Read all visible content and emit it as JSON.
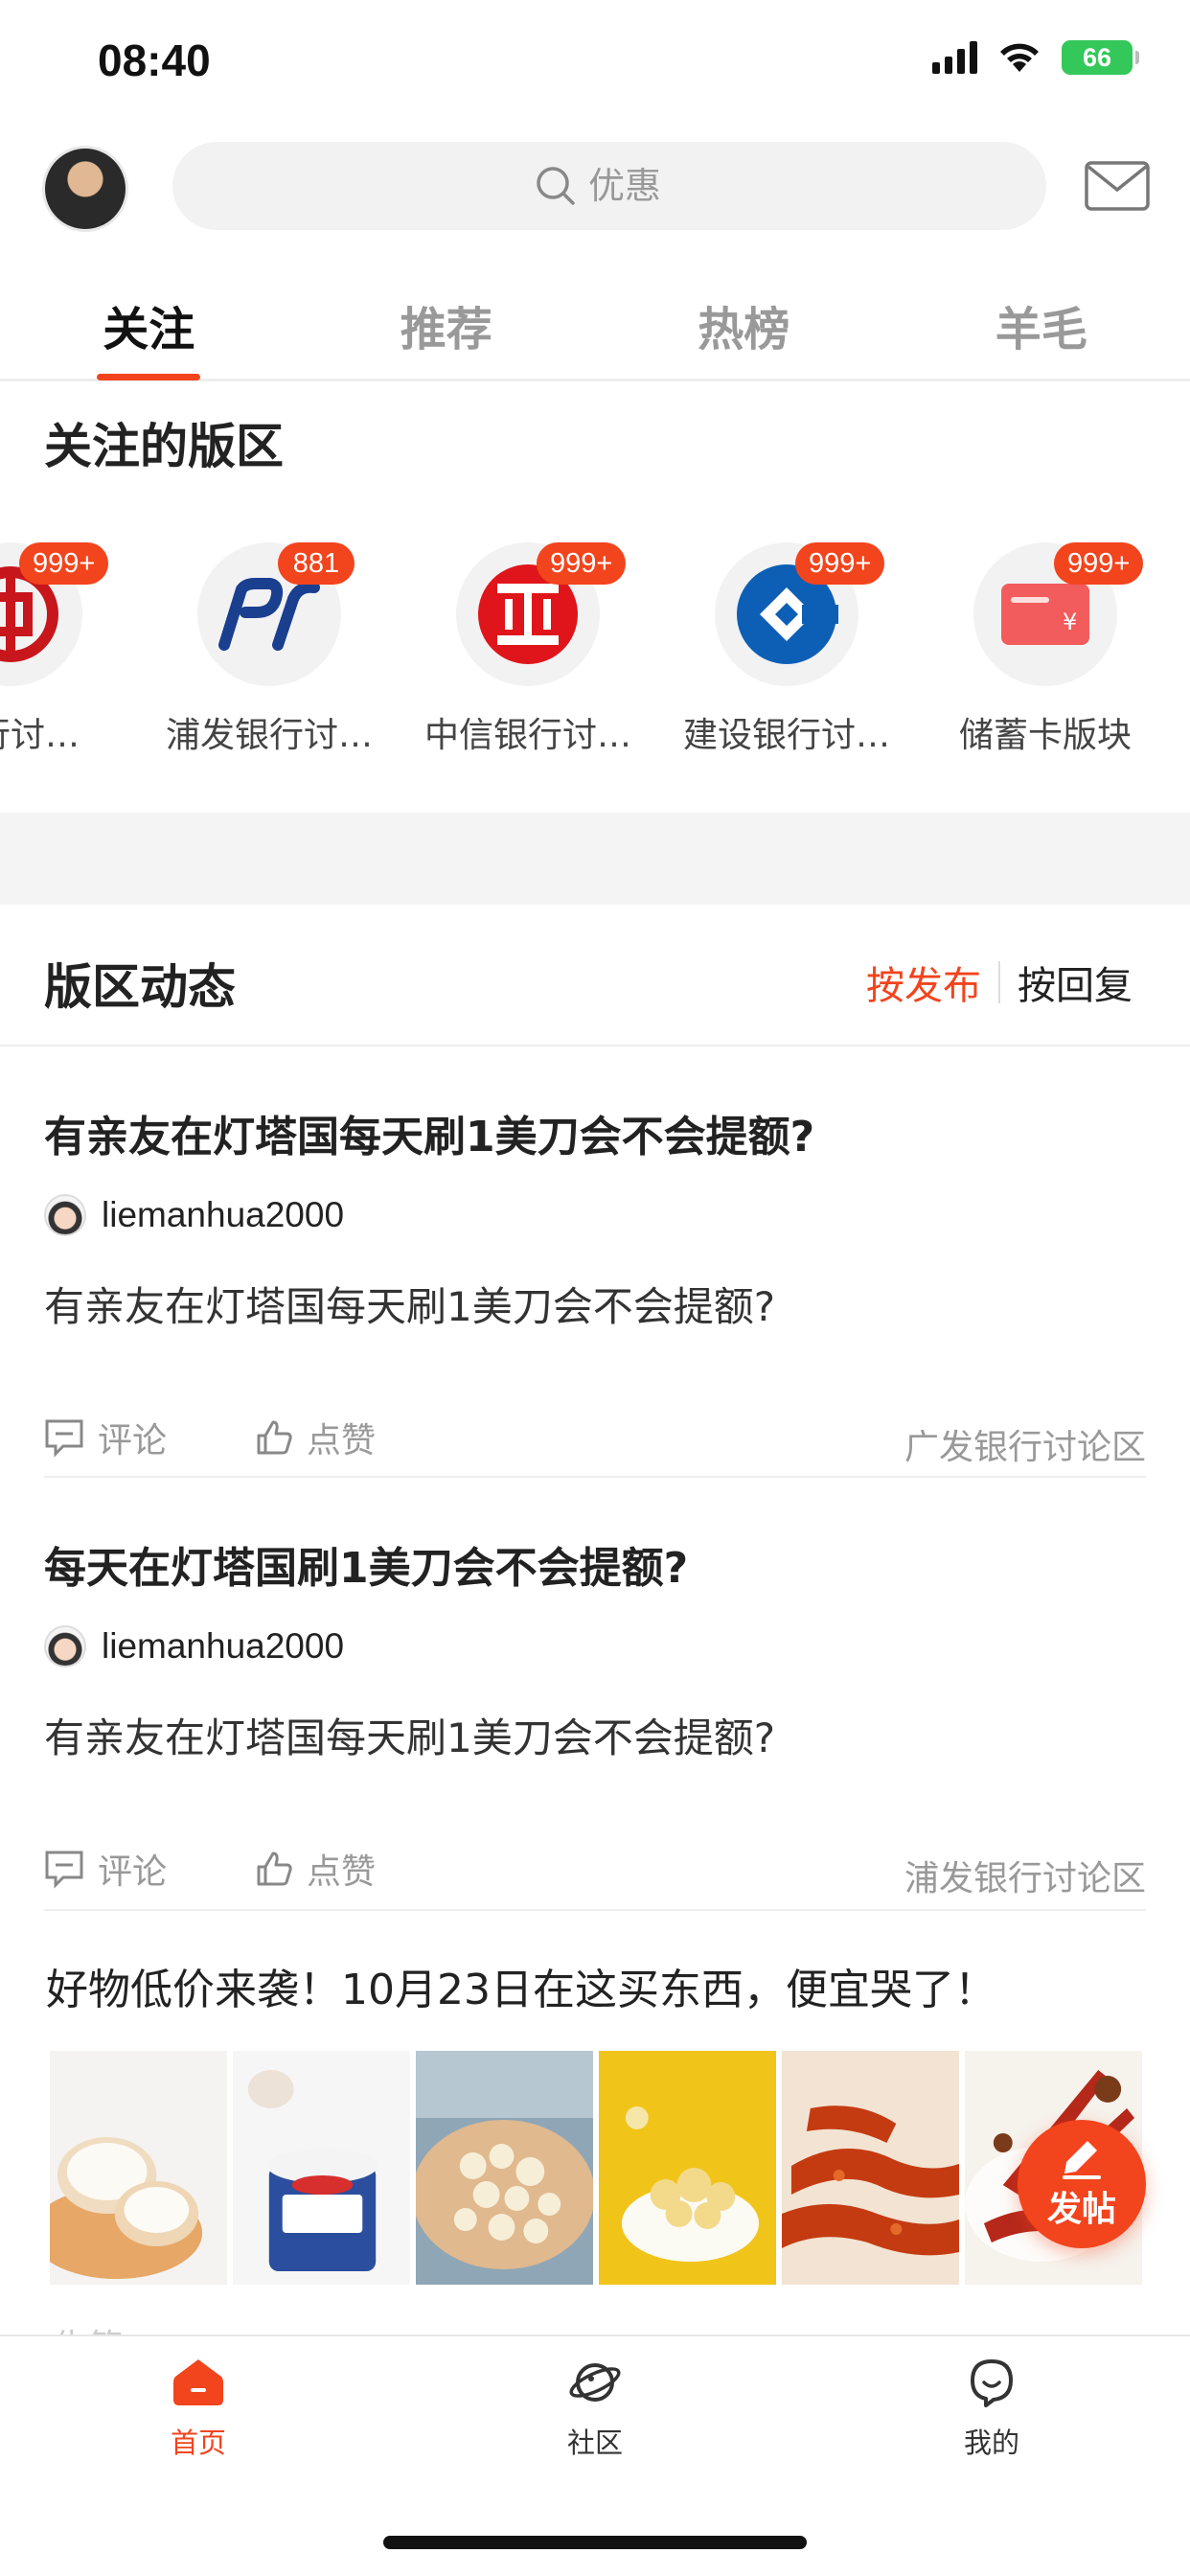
{
  "status_bar": {
    "time": "08:40",
    "battery": "66"
  },
  "header": {
    "search_placeholder": "优惠"
  },
  "tabs": [
    {
      "label": "关注",
      "active": true
    },
    {
      "label": "推荐",
      "active": false
    },
    {
      "label": "热榜",
      "active": false
    },
    {
      "label": "羊毛",
      "active": false
    }
  ],
  "followed": {
    "title": "关注的版区",
    "forums": [
      {
        "label": "银行讨…",
        "badge": "999+",
        "icon": "bank-of-china-logo"
      },
      {
        "label": "浦发银行讨…",
        "badge": "881",
        "icon": "spdb-logo"
      },
      {
        "label": "中信银行讨…",
        "badge": "999+",
        "icon": "citic-logo"
      },
      {
        "label": "建设银行讨…",
        "badge": "999+",
        "icon": "ccb-logo"
      },
      {
        "label": "储蓄卡版块",
        "badge": "999+",
        "icon": "debit-card-icon"
      }
    ]
  },
  "news": {
    "title": "版区动态",
    "sort_active": "按发布",
    "sort_other": "按回复"
  },
  "posts": [
    {
      "title": "有亲友在灯塔国每天刷1美刀会不会提额?",
      "author": "liemanhua2000",
      "body": "有亲友在灯塔国每天刷1美刀会不会提额?",
      "comment_label": "评论",
      "like_label": "点赞",
      "forum": "广发银行讨论区"
    },
    {
      "title": "每天在灯塔国刷1美刀会不会提额?",
      "author": "liemanhua2000",
      "body": "有亲友在灯塔国每天刷1美刀会不会提额?",
      "comment_label": "评论",
      "like_label": "点赞",
      "forum": "浦发银行讨论区"
    }
  ],
  "promo": {
    "title": "好物低价来袭！10月23日在这买东西，便宜哭了！",
    "peek_text": "告第"
  },
  "fab": {
    "label": "发帖"
  },
  "bottom_nav": [
    {
      "label": "首页",
      "active": true
    },
    {
      "label": "社区",
      "active": false
    },
    {
      "label": "我的",
      "active": false
    }
  ],
  "colors": {
    "accent": "#f2441d",
    "battery": "#34c759"
  }
}
